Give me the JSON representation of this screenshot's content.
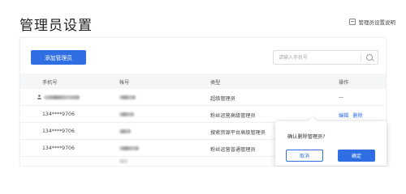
{
  "page": {
    "title": "管理员设置",
    "help_link": "管理员设置说明"
  },
  "toolbar": {
    "add_button": "添加管理员",
    "search_placeholder": "请输入手机号"
  },
  "table": {
    "columns": [
      "手机号",
      "帐号",
      "类型",
      "操作"
    ],
    "rows": [
      {
        "phone": "",
        "type": "超级管理员",
        "actions": [
          "—"
        ]
      },
      {
        "phone": "134****9706",
        "type": "粉丝运营高级管理员",
        "actions": [
          "编辑",
          "删除"
        ]
      },
      {
        "phone": "134****9706",
        "type": "搜索资源平台高级管理员",
        "actions": []
      },
      {
        "phone": "134****9706",
        "type": "粉丝运营普通管理员",
        "actions": []
      }
    ]
  },
  "popconfirm": {
    "message": "确认删除管理员?",
    "cancel": "取消",
    "confirm": "确定"
  },
  "colors": {
    "primary": "#2f6fe3",
    "header_bg": "#f5f6f8"
  },
  "icons": [
    "help-doc-icon",
    "search-icon",
    "user-icon"
  ]
}
